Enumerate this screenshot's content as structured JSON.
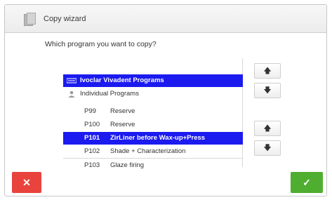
{
  "window": {
    "title": "Copy wizard",
    "icon": "pages-icon"
  },
  "question": "Which program you want to copy?",
  "groups": [
    {
      "label": "Ivoclar Vivadent Programs",
      "icon": "ivoclar-logo-icon",
      "selected": true
    },
    {
      "label": "Individual Programs",
      "icon": "user-icon",
      "selected": false
    }
  ],
  "programs": [
    {
      "num": "P99",
      "name": "Reserve",
      "selected": false
    },
    {
      "num": "P100",
      "name": "Reserve",
      "selected": false
    },
    {
      "num": "P101",
      "name": "ZirLiner before Wax-up+Press",
      "selected": true
    },
    {
      "num": "P102",
      "name": "Shade + Characterization",
      "selected": false
    },
    {
      "num": "P103",
      "name": "Glaze firing",
      "selected": false
    }
  ],
  "buttons": {
    "up": "🡅",
    "down": "🡇",
    "cancel": "✕",
    "ok": "✓"
  },
  "colors": {
    "selection": "#1b1bf0",
    "cancel": "#e8433d",
    "ok": "#4fae2f"
  }
}
